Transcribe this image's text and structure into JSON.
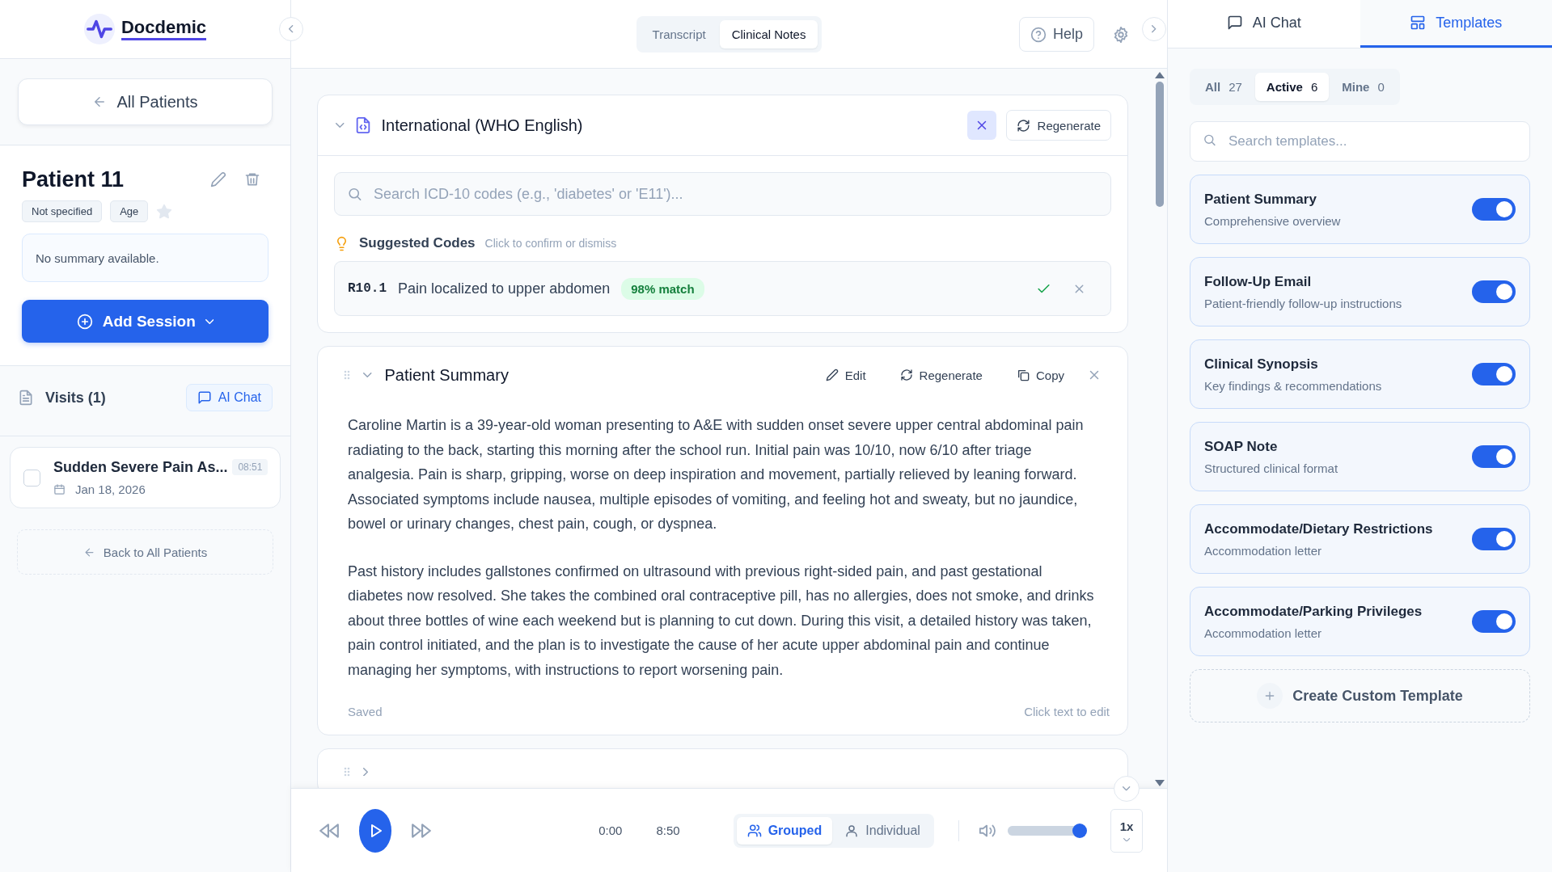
{
  "sidebar": {
    "logo": "Docdemic",
    "back_button": "All Patients",
    "patient": {
      "name": "Patient 11",
      "tags": [
        "Not specified",
        "Age"
      ],
      "starred": false,
      "summary": "No summary available."
    },
    "add_session_button": "Add Session",
    "visits": {
      "title": "Visits (1)",
      "ai_chat_button": "AI Chat",
      "items": [
        {
          "title": "Sudden Severe Pain As...",
          "time": "08:51",
          "date": "Jan 18, 2026",
          "checked": false
        }
      ]
    },
    "back_link": "Back to All Patients"
  },
  "header": {
    "view_tabs": [
      {
        "label": "Transcript",
        "selected": false
      },
      {
        "label": "Clinical Notes",
        "selected": true
      }
    ],
    "help_button": "Help"
  },
  "coding_card": {
    "title": "International (WHO English)",
    "regenerate_button": "Regenerate",
    "search": {
      "placeholder": "Search ICD-10 codes (e.g., 'diabetes' or 'E11')..."
    },
    "suggested": {
      "title": "Suggested Codes",
      "hint": "Click to confirm or dismiss"
    },
    "codes": [
      {
        "code": "R10.1",
        "description": "Pain localized to upper abdomen",
        "match": "98% match"
      }
    ]
  },
  "note_cards": [
    {
      "title": "Patient Summary",
      "expanded": true,
      "actions": [
        "Edit",
        "Regenerate",
        "Copy"
      ],
      "paragraphs": [
        "Caroline Martin is a 39-year-old woman presenting to A&E with sudden onset severe upper central abdominal pain radiating to the back, starting this morning after the school run. Initial pain was 10/10, now 6/10 after triage analgesia. Pain is sharp, gripping, worse on deep inspiration and movement, partially relieved by leaning forward. Associated symptoms include nausea, multiple episodes of vomiting, and feeling hot and sweaty, but no jaundice, bowel or urinary changes, chest pain, cough, or dyspnea.",
        "Past history includes gallstones confirmed on ultrasound with previous right-sided pain, and past gestational diabetes now resolved. She takes the combined oral contraceptive pill, has no allergies, does not smoke, and drinks about three bottles of wine each weekend but is planning to cut down. During this visit, a detailed history was taken, pain control initiated, and the plan is to investigate the cause of her acute upper abdominal pain and continue managing her symptoms, with instructions to report worsening pain."
      ],
      "status": "Saved",
      "hint": "Click text to edit"
    },
    {
      "expanded": false
    }
  ],
  "player": {
    "time_current": "0:00",
    "time_total": "8:50",
    "view_modes": [
      {
        "label": "Grouped",
        "kind": "group",
        "selected": true
      },
      {
        "label": "Individual",
        "kind": "single",
        "selected": false
      }
    ],
    "volume": {
      "level": 0.94
    },
    "speed": "1x"
  },
  "right_panel": {
    "tabs": [
      {
        "label": "AI Chat",
        "kind": "chat",
        "selected": false
      },
      {
        "label": "Templates",
        "kind": "templates",
        "selected": true
      }
    ],
    "filters": [
      {
        "label": "All",
        "count": "27",
        "selected": false
      },
      {
        "label": "Active",
        "count": "6",
        "selected": true
      },
      {
        "label": "Mine",
        "count": "0",
        "selected": false
      }
    ],
    "search": {
      "placeholder": "Search templates..."
    },
    "templates": [
      {
        "name": "Patient Summary",
        "description": "Comprehensive overview",
        "on": true
      },
      {
        "name": "Follow-Up Email",
        "description": "Patient-friendly follow-up instructions",
        "on": true
      },
      {
        "name": "Clinical Synopsis",
        "description": "Key findings & recommendations",
        "on": true
      },
      {
        "name": "SOAP Note",
        "description": "Structured clinical format",
        "on": true
      },
      {
        "name": "Accommodate/Dietary Restrictions",
        "description": "Accommodation letter",
        "on": true
      },
      {
        "name": "Accommodate/Parking Privileges",
        "description": "Accommodation letter",
        "on": true
      }
    ],
    "create_button": "Create Custom Template"
  }
}
